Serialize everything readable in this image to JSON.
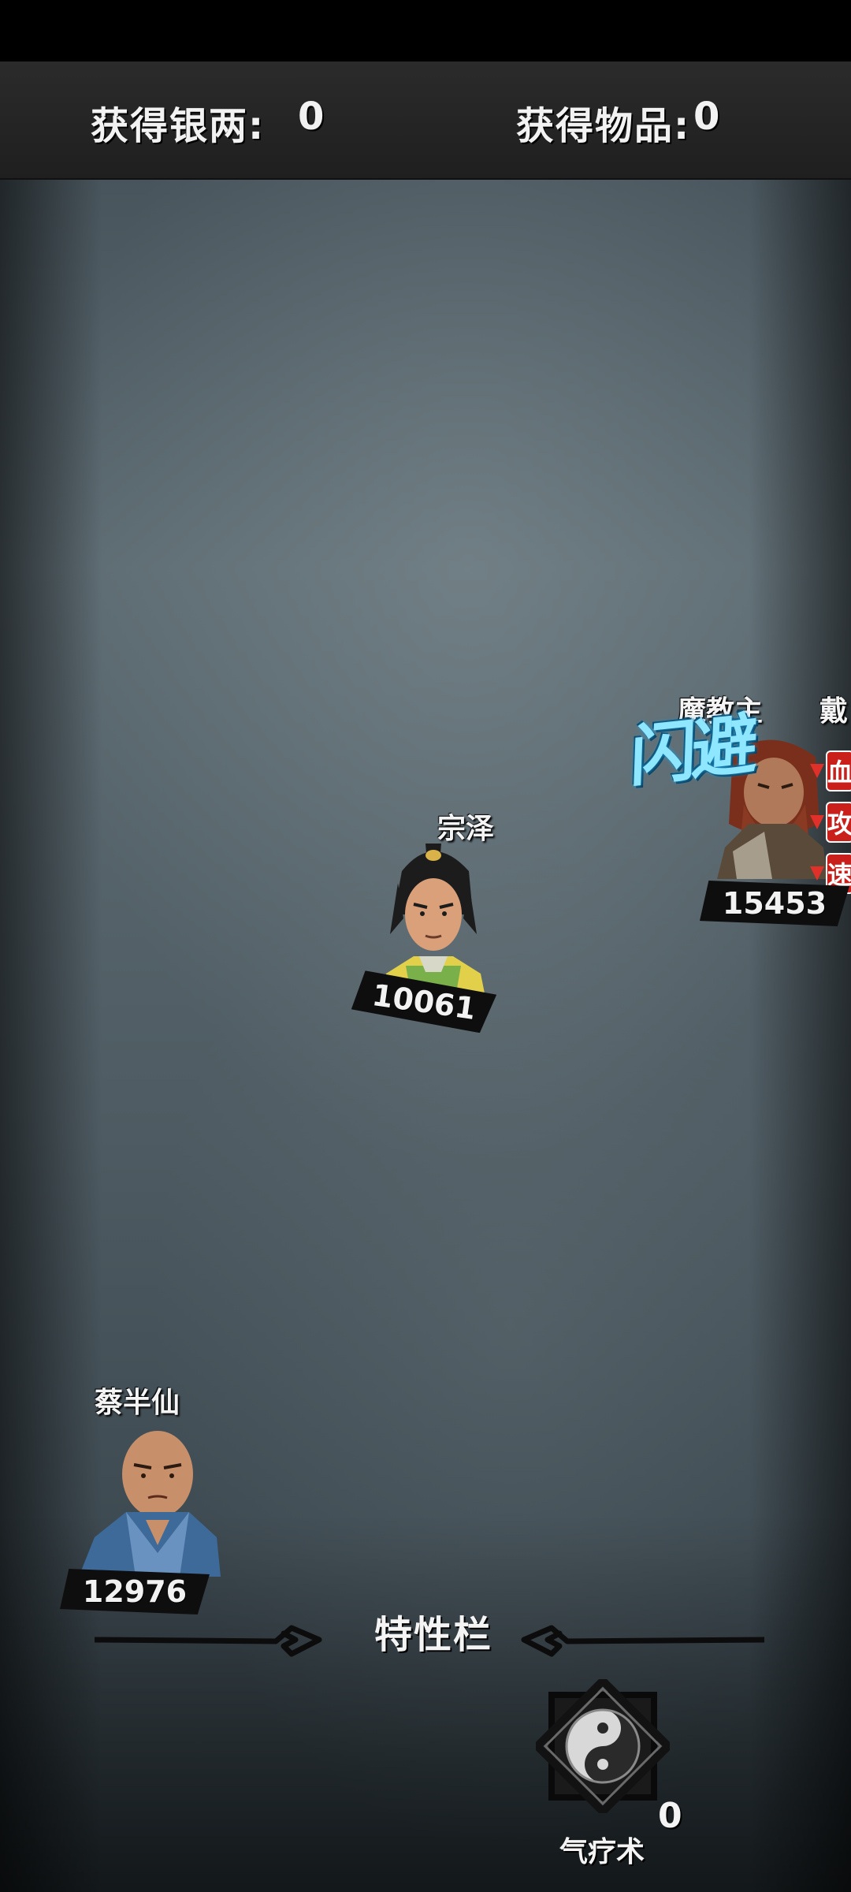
{
  "header": {
    "silver_label": "获得银两:",
    "silver_value": "0",
    "items_label": "获得物品:",
    "items_value": "0"
  },
  "units": {
    "zongze": {
      "name": "宗泽",
      "hp": "10061"
    },
    "caibanxian": {
      "name": "蔡半仙",
      "hp": "12976"
    },
    "enemy": {
      "name": "魔教主",
      "name2": "戴",
      "hp": "15453",
      "status_text": "闪避"
    }
  },
  "debuffs": [
    {
      "label": "血",
      "icon": "down-arrow-icon"
    },
    {
      "label": "攻",
      "icon": "down-arrow-icon"
    },
    {
      "label": "速",
      "icon": "down-arrow-icon"
    }
  ],
  "trait_bar": {
    "title": "特性栏"
  },
  "skill": {
    "name": "气疗术",
    "count": "0",
    "icon": "yin-yang-skill-icon"
  },
  "colors": {
    "dodge_text": "#8fe6ff",
    "debuff_red": "#c9201c",
    "hp_plate": "#0e0e0e"
  }
}
